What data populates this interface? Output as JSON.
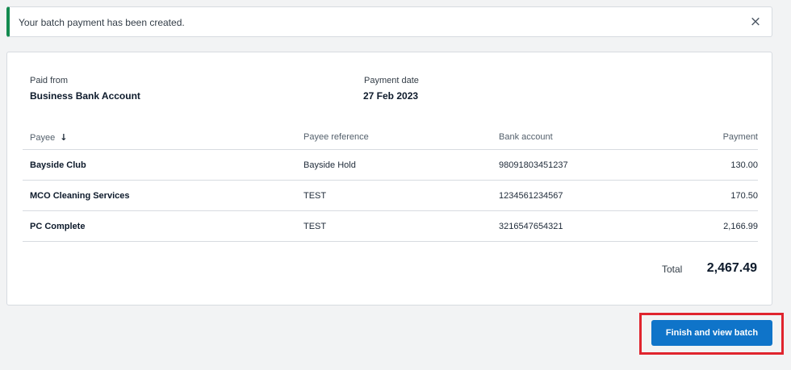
{
  "notification": {
    "message": "Your batch payment has been created.",
    "close_glyph": "×"
  },
  "summary": {
    "paid_from_label": "Paid from",
    "paid_from_value": "Business Bank Account",
    "payment_date_label": "Payment date",
    "payment_date_value": "27 Feb 2023"
  },
  "table": {
    "headers": {
      "payee": "Payee",
      "payee_reference": "Payee reference",
      "bank_account": "Bank account",
      "payment": "Payment"
    },
    "sort_icon": "arrow-down-icon",
    "rows": [
      {
        "payee": "Bayside Club",
        "payee_reference": "Bayside Hold",
        "bank_account": "98091803451237",
        "payment": "130.00"
      },
      {
        "payee": "MCO Cleaning Services",
        "payee_reference": "TEST",
        "bank_account": "1234561234567",
        "payment": "170.50"
      },
      {
        "payee": "PC Complete",
        "payee_reference": "TEST",
        "bank_account": "3216547654321",
        "payment": "2,166.99"
      }
    ]
  },
  "total": {
    "label": "Total",
    "value": "2,467.49"
  },
  "actions": {
    "finish_label": "Finish and view batch"
  },
  "colors": {
    "success_accent": "#138a4f",
    "primary_button": "#0f74c9",
    "highlight_box": "#e0242e"
  }
}
